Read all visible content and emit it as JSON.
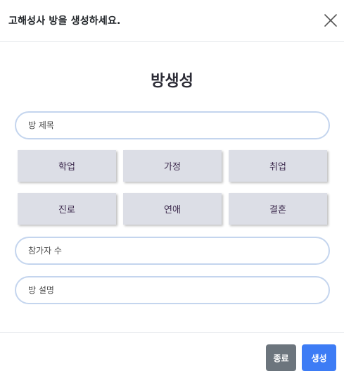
{
  "header": {
    "title": "고해성사 방을 생성하세요.",
    "close_icon": "close-x-icon"
  },
  "body": {
    "title": "방생성",
    "room_title_input": {
      "placeholder": "방 제목",
      "value": ""
    },
    "categories": [
      "학업",
      "가정",
      "취업",
      "진로",
      "연애",
      "결혼"
    ],
    "participants_input": {
      "placeholder": "참가자 수",
      "value": ""
    },
    "description_input": {
      "placeholder": "방 설명",
      "value": ""
    }
  },
  "footer": {
    "close_label": "종료",
    "create_label": "생성"
  },
  "colors": {
    "input_border": "#c4d5ee",
    "category_bg": "#dcdee6",
    "close_button": "#6c757d",
    "create_button": "#3d7cf5"
  }
}
